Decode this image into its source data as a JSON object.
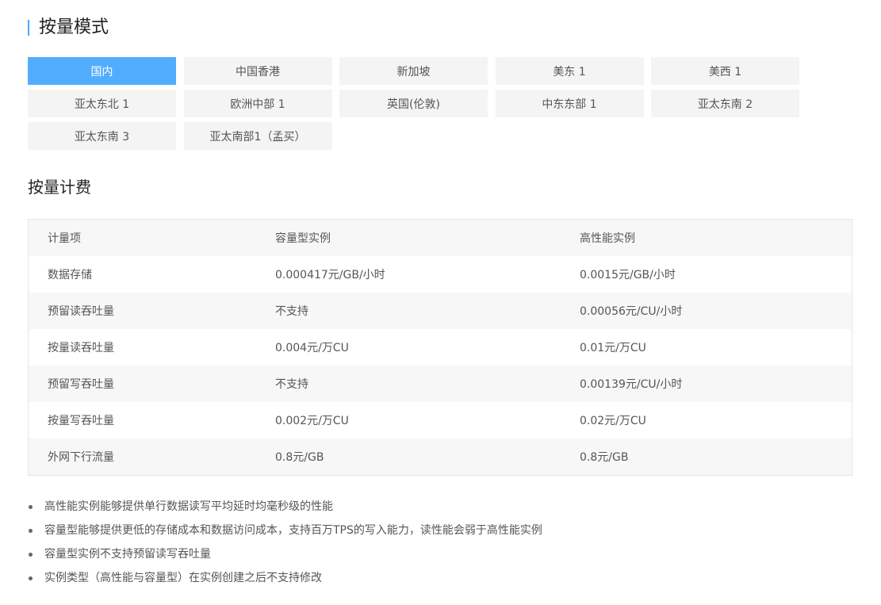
{
  "header": {
    "title": "按量模式"
  },
  "regions": [
    {
      "label": "国内",
      "active": true
    },
    {
      "label": "中国香港",
      "active": false
    },
    {
      "label": "新加坡",
      "active": false
    },
    {
      "label": "美东 1",
      "active": false
    },
    {
      "label": "美西 1",
      "active": false
    },
    {
      "label": "亚太东北 1",
      "active": false
    },
    {
      "label": "欧洲中部 1",
      "active": false
    },
    {
      "label": "英国(伦敦)",
      "active": false
    },
    {
      "label": "中东东部 1",
      "active": false
    },
    {
      "label": "亚太东南 2",
      "active": false
    },
    {
      "label": "亚太东南 3",
      "active": false
    },
    {
      "label": "亚太南部1（孟买）",
      "active": false
    }
  ],
  "billing": {
    "title": "按量计费",
    "columns": [
      "计量项",
      "容量型实例",
      "高性能实例"
    ],
    "rows": [
      [
        "数据存储",
        "0.000417元/GB/小时",
        "0.0015元/GB/小时"
      ],
      [
        "预留读吞吐量",
        "不支持",
        "0.00056元/CU/小时"
      ],
      [
        "按量读吞吐量",
        "0.004元/万CU",
        "0.01元/万CU"
      ],
      [
        "预留写吞吐量",
        "不支持",
        "0.00139元/CU/小时"
      ],
      [
        "按量写吞吐量",
        "0.002元/万CU",
        "0.02元/万CU"
      ],
      [
        "外网下行流量",
        "0.8元/GB",
        "0.8元/GB"
      ]
    ]
  },
  "notes": [
    "高性能实例能够提供单行数据读写平均延时均毫秒级的性能",
    "容量型能够提供更低的存储成本和数据访问成本，支持百万TPS的写入能力，读性能会弱于高性能实例",
    "容量型实例不支持预留读写吞吐量",
    "实例类型（高性能与容量型）在实例创建之后不支持修改"
  ],
  "colors": {
    "accent": "#52adff",
    "title_bar": "#4ca8ff",
    "inactive_tab": "#f4f4f4",
    "row_shade": "#f7f7f7"
  }
}
